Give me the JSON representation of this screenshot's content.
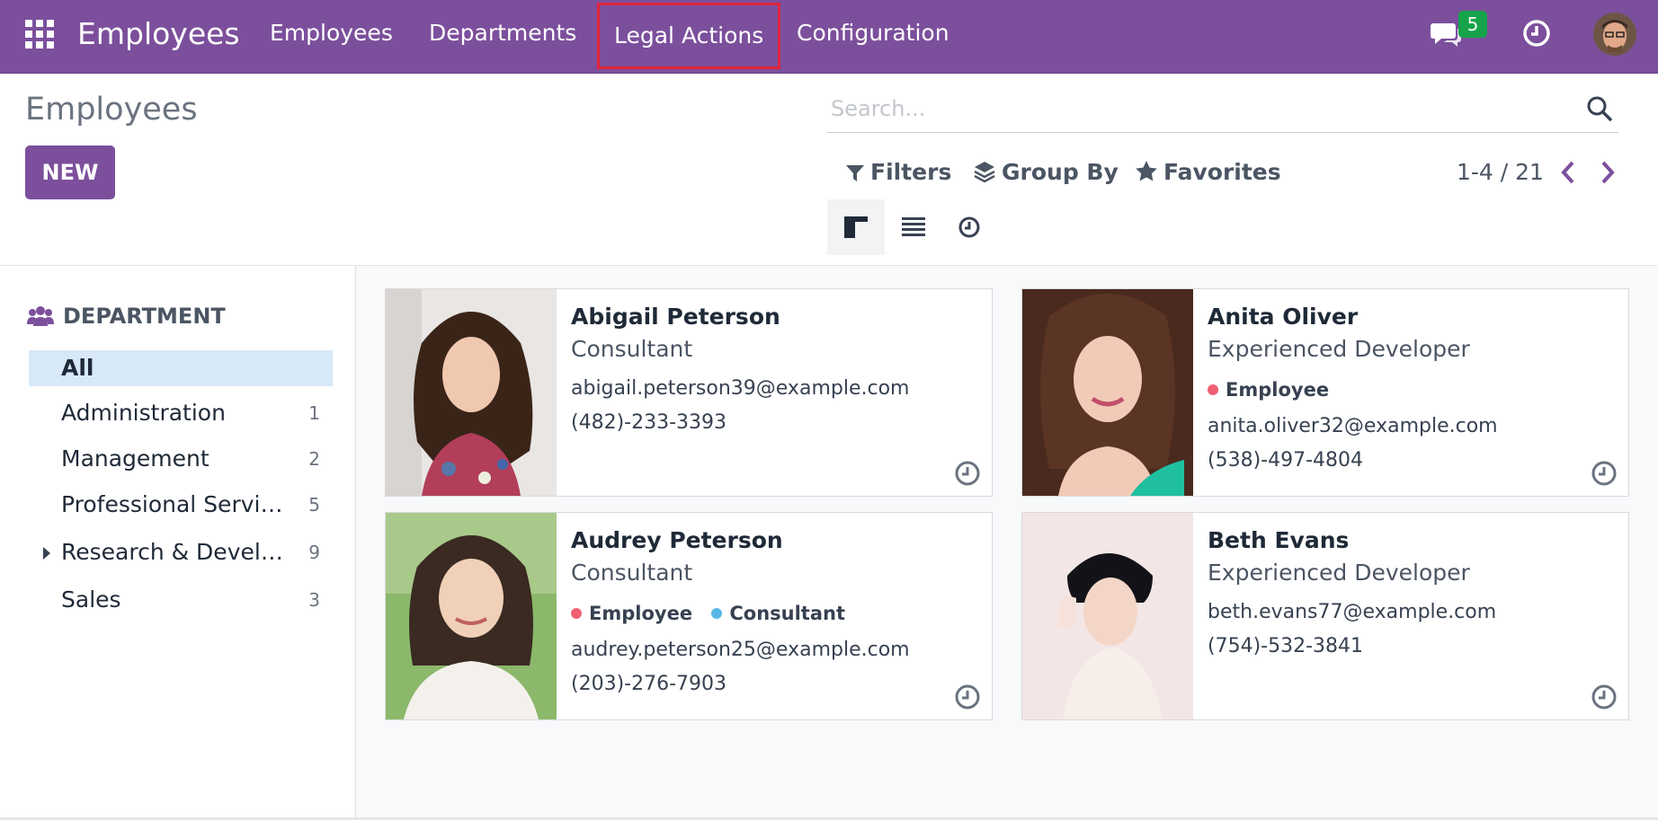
{
  "navbar": {
    "app_title": "Employees",
    "menu": [
      {
        "label": "Employees"
      },
      {
        "label": "Departments"
      },
      {
        "label": "Legal Actions"
      },
      {
        "label": "Configuration"
      }
    ],
    "message_count": "5",
    "icons": [
      "apps-grid-icon",
      "chat-icon",
      "clock-icon",
      "user-avatar"
    ],
    "colors": {
      "brand": "#7c4f9c",
      "highlight": "#e0253c",
      "badge": "#16a34a"
    }
  },
  "control": {
    "title": "Employees",
    "new_label": "NEW",
    "search_placeholder": "Search...",
    "filters_label": "Filters",
    "groupby_label": "Group By",
    "favorites_label": "Favorites",
    "pager_text": "1-4 / 21",
    "views": [
      "kanban-view-icon",
      "list-view-icon",
      "activity-view-icon"
    ]
  },
  "sidepanel": {
    "header": "DEPARTMENT",
    "items": [
      {
        "label": "All",
        "count": ""
      },
      {
        "label": "Administration",
        "count": "1"
      },
      {
        "label": "Management",
        "count": "2"
      },
      {
        "label": "Professional Services",
        "count": "5"
      },
      {
        "label": "Research & Development",
        "count": "9"
      },
      {
        "label": "Sales",
        "count": "3"
      }
    ]
  },
  "employees": [
    {
      "name": "Abigail Peterson",
      "job": "Consultant",
      "tags": [],
      "email": "abigail.peterson39@example.com",
      "phone": "(482)-233-3393"
    },
    {
      "name": "Anita Oliver",
      "job": "Experienced Developer",
      "tags": [
        {
          "label": "Employee",
          "color": "#f06073"
        }
      ],
      "email": "anita.oliver32@example.com",
      "phone": "(538)-497-4804"
    },
    {
      "name": "Audrey Peterson",
      "job": "Consultant",
      "tags": [
        {
          "label": "Employee",
          "color": "#f06073"
        },
        {
          "label": "Consultant",
          "color": "#5bb8e6"
        }
      ],
      "email": "audrey.peterson25@example.com",
      "phone": "(203)-276-7903"
    },
    {
      "name": "Beth Evans",
      "job": "Experienced Developer",
      "tags": [],
      "email": "beth.evans77@example.com",
      "phone": "(754)-532-3841"
    }
  ]
}
